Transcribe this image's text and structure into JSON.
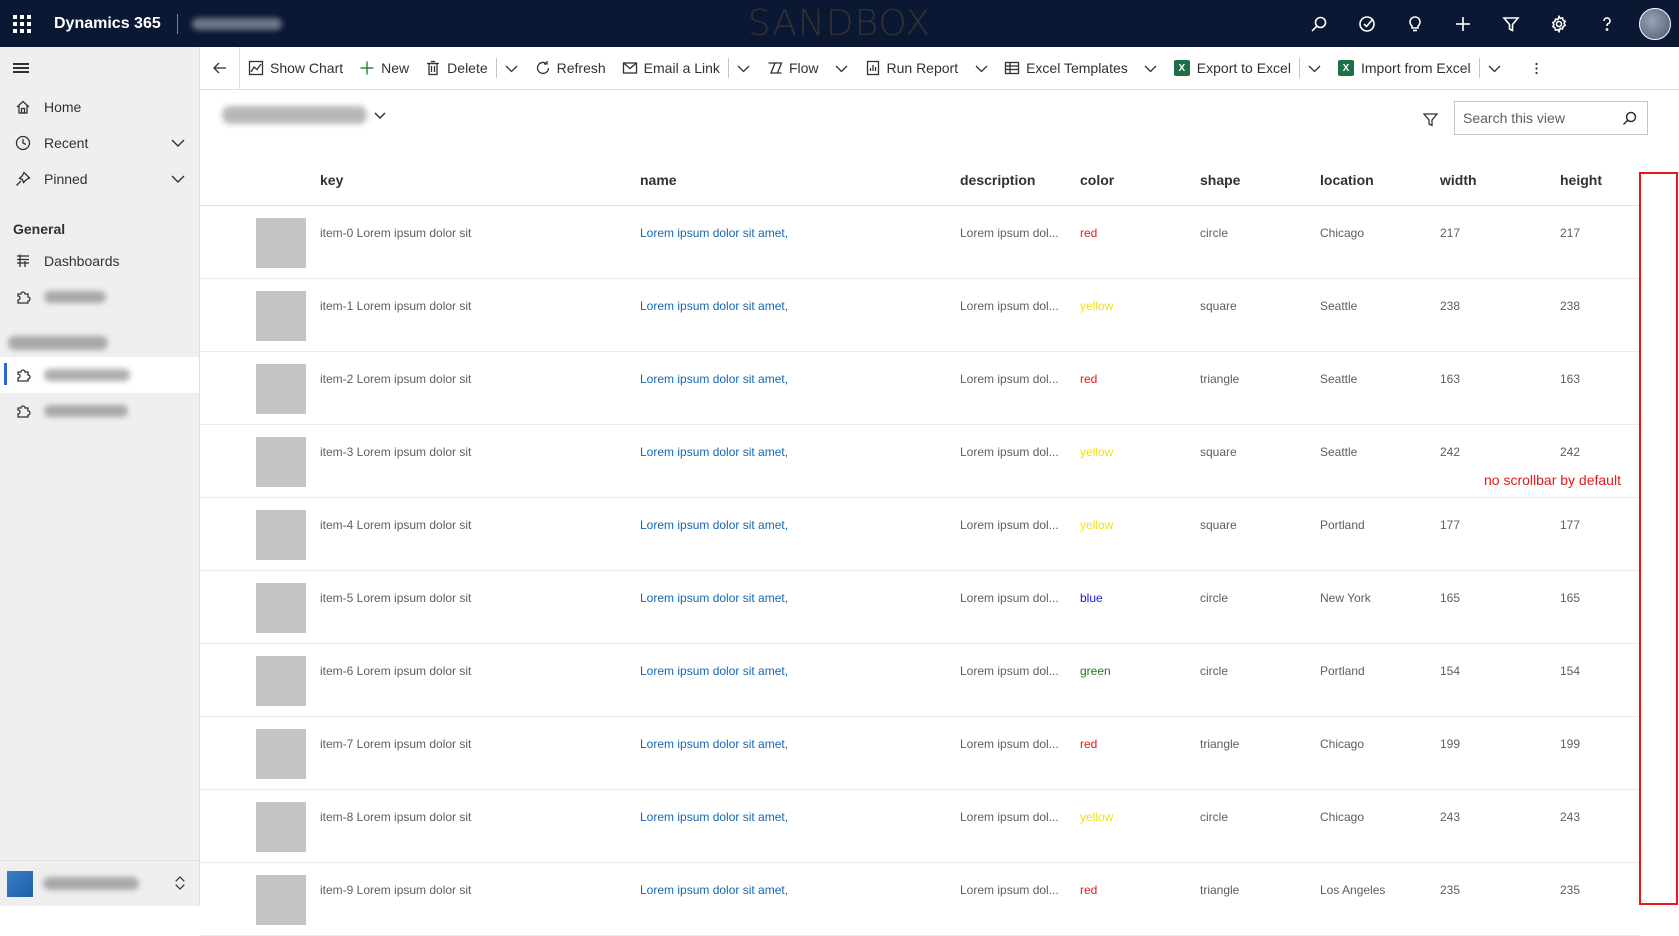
{
  "topbar": {
    "brand": "Dynamics 365",
    "environment_banner": "SANDBOX",
    "icons": [
      "search-icon",
      "task-icon",
      "lightbulb-icon",
      "plus-icon",
      "filter-icon",
      "gear-icon",
      "help-icon",
      "avatar"
    ]
  },
  "sidebar": {
    "items": [
      {
        "label": "Home",
        "icon": "home-icon"
      },
      {
        "label": "Recent",
        "icon": "clock-icon"
      },
      {
        "label": "Pinned",
        "icon": "pin-icon"
      }
    ],
    "section_general": "General",
    "general_items": [
      {
        "label": "Dashboards",
        "icon": "dashboard-icon"
      }
    ]
  },
  "commandbar": {
    "show_chart": "Show Chart",
    "new": "New",
    "delete": "Delete",
    "refresh": "Refresh",
    "email_link": "Email a Link",
    "flow": "Flow",
    "run_report": "Run Report",
    "excel_templates": "Excel Templates",
    "export_excel": "Export to Excel",
    "import_excel": "Import from Excel"
  },
  "view": {
    "search_placeholder": "Search this view"
  },
  "grid": {
    "columns": [
      "key",
      "name",
      "description",
      "color",
      "shape",
      "location",
      "width",
      "height"
    ],
    "rows": [
      {
        "key": "item-0 Lorem ipsum dolor sit",
        "name": "Lorem ipsum dolor sit amet,",
        "description": "Lorem ipsum dol...",
        "color": "red",
        "shape": "circle",
        "location": "Chicago",
        "width": "217",
        "height": "217"
      },
      {
        "key": "item-1 Lorem ipsum dolor sit",
        "name": "Lorem ipsum dolor sit amet,",
        "description": "Lorem ipsum dol...",
        "color": "yellow",
        "shape": "square",
        "location": "Seattle",
        "width": "238",
        "height": "238"
      },
      {
        "key": "item-2 Lorem ipsum dolor sit",
        "name": "Lorem ipsum dolor sit amet,",
        "description": "Lorem ipsum dol...",
        "color": "red",
        "shape": "triangle",
        "location": "Seattle",
        "width": "163",
        "height": "163"
      },
      {
        "key": "item-3 Lorem ipsum dolor sit",
        "name": "Lorem ipsum dolor sit amet,",
        "description": "Lorem ipsum dol...",
        "color": "yellow",
        "shape": "square",
        "location": "Seattle",
        "width": "242",
        "height": "242"
      },
      {
        "key": "item-4 Lorem ipsum dolor sit",
        "name": "Lorem ipsum dolor sit amet,",
        "description": "Lorem ipsum dol...",
        "color": "yellow",
        "shape": "square",
        "location": "Portland",
        "width": "177",
        "height": "177"
      },
      {
        "key": "item-5 Lorem ipsum dolor sit",
        "name": "Lorem ipsum dolor sit amet,",
        "description": "Lorem ipsum dol...",
        "color": "blue",
        "shape": "circle",
        "location": "New York",
        "width": "165",
        "height": "165"
      },
      {
        "key": "item-6 Lorem ipsum dolor sit",
        "name": "Lorem ipsum dolor sit amet,",
        "description": "Lorem ipsum dol...",
        "color": "green",
        "shape": "circle",
        "location": "Portland",
        "width": "154",
        "height": "154"
      },
      {
        "key": "item-7 Lorem ipsum dolor sit",
        "name": "Lorem ipsum dolor sit amet,",
        "description": "Lorem ipsum dol...",
        "color": "red",
        "shape": "triangle",
        "location": "Chicago",
        "width": "199",
        "height": "199"
      },
      {
        "key": "item-8 Lorem ipsum dolor sit",
        "name": "Lorem ipsum dolor sit amet,",
        "description": "Lorem ipsum dol...",
        "color": "yellow",
        "shape": "circle",
        "location": "Chicago",
        "width": "243",
        "height": "243"
      },
      {
        "key": "item-9 Lorem ipsum dolor sit",
        "name": "Lorem ipsum dolor sit amet,",
        "description": "Lorem ipsum dol...",
        "color": "red",
        "shape": "triangle",
        "location": "Los Angeles",
        "width": "235",
        "height": "235"
      }
    ],
    "color_map": {
      "red": "#e8171c",
      "yellow": "#f2e20d",
      "blue": "#1a1ad6",
      "green": "#1f7a1f"
    }
  },
  "annotation": {
    "text": "no scrollbar by default",
    "color": "#e8171c"
  }
}
